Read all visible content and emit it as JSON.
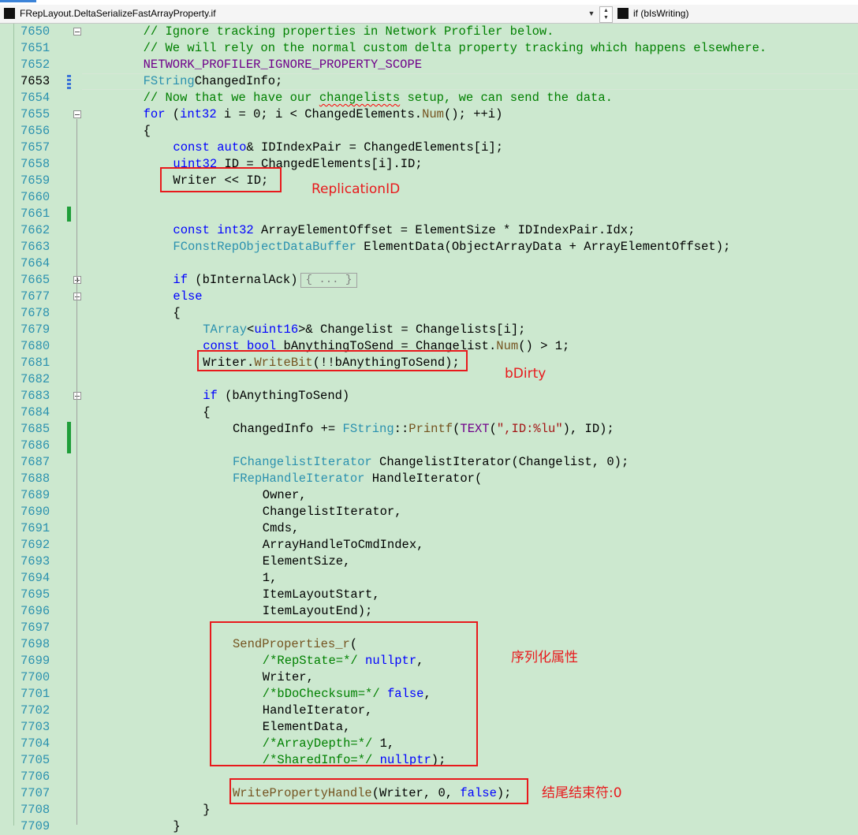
{
  "navbar": {
    "scope": "FRepLayout.DeltaSerializeFastArrayProperty.if",
    "member": "if (bIsWriting)"
  },
  "editor": {
    "active_line": "7653",
    "lines": [
      {
        "n": "7650",
        "fold": "minus",
        "t": [
          [
            "cm",
            "// Ignore tracking properties in Network Profiler below."
          ]
        ],
        "ind": 2
      },
      {
        "n": "7651",
        "t": [
          [
            "cm",
            "// We will rely on the normal custom delta property tracking which happens elsewhere."
          ]
        ],
        "ind": 2
      },
      {
        "n": "7652",
        "t": [
          [
            "mac",
            "NETWORK_PROFILER_IGNORE_PROPERTY_SCOPE"
          ]
        ],
        "ind": 2
      },
      {
        "n": "7653",
        "t": [
          [
            "ty",
            "FString"
          ],
          [
            "",
            "ChangedInfo;"
          ]
        ],
        "ind": 2,
        "sp": [
          1
        ]
      },
      {
        "n": "7654",
        "t": [
          [
            "cm",
            "// Now that we have our "
          ],
          [
            "cmsq",
            "changelists"
          ],
          [
            "cm",
            " setup, we can send the data."
          ]
        ],
        "ind": 2
      },
      {
        "n": "7655",
        "fold": "minus",
        "t": [
          [
            "kw",
            "for"
          ],
          [
            "",
            " ("
          ],
          [
            "kw",
            "int32"
          ],
          [
            "",
            " i = 0; i < ChangedElements."
          ],
          [
            "fn",
            "Num"
          ],
          [
            "",
            "(); ++i)"
          ]
        ],
        "ind": 2
      },
      {
        "n": "7656",
        "t": [
          [
            "",
            "{"
          ]
        ],
        "ind": 2
      },
      {
        "n": "7657",
        "t": [
          [
            "kw",
            "const"
          ],
          [
            "",
            " "
          ],
          [
            "kw",
            "auto"
          ],
          [
            "",
            "& IDIndexPair = ChangedElements[i];"
          ]
        ],
        "ind": 3
      },
      {
        "n": "7658",
        "t": [
          [
            "kw",
            "uint32"
          ],
          [
            "",
            " ID = ChangedElements[i].ID;"
          ]
        ],
        "ind": 3
      },
      {
        "n": "7659",
        "t": [
          [
            "",
            "Writer << ID;"
          ]
        ],
        "ind": 3
      },
      {
        "n": "7660",
        "t": [],
        "ind": 3
      },
      {
        "n": "7661",
        "t": [],
        "ind": 3
      },
      {
        "n": "7662",
        "t": [
          [
            "kw",
            "const"
          ],
          [
            "",
            " "
          ],
          [
            "kw",
            "int32"
          ],
          [
            "",
            " ArrayElementOffset = ElementSize * IDIndexPair.Idx;"
          ]
        ],
        "ind": 3
      },
      {
        "n": "7663",
        "t": [
          [
            "ty",
            "FConstRepObjectDataBuffer"
          ],
          [
            "",
            " ElementData(ObjectArrayData + ArrayElementOffset);"
          ]
        ],
        "ind": 3
      },
      {
        "n": "7664",
        "t": [],
        "ind": 3
      },
      {
        "n": "7665",
        "fold": "plus",
        "t": [
          [
            "kw",
            "if"
          ],
          [
            "",
            " (bInternalAck)"
          ],
          [
            "col",
            "{ ... }"
          ]
        ],
        "ind": 3
      },
      {
        "n": "7677",
        "fold": "minus",
        "t": [
          [
            "kw",
            "else"
          ]
        ],
        "ind": 3
      },
      {
        "n": "7678",
        "t": [
          [
            "",
            "{"
          ]
        ],
        "ind": 3
      },
      {
        "n": "7679",
        "t": [
          [
            "ty",
            "TArray"
          ],
          [
            "",
            "<"
          ],
          [
            "kw",
            "uint16"
          ],
          [
            "",
            ">& Changelist = Changelists[i];"
          ]
        ],
        "ind": 4
      },
      {
        "n": "7680",
        "t": [
          [
            "kw",
            "const"
          ],
          [
            "",
            " "
          ],
          [
            "kw",
            "bool"
          ],
          [
            "",
            " bAnythingToSend = Changelist."
          ],
          [
            "fn",
            "Num"
          ],
          [
            "",
            "() > 1;"
          ]
        ],
        "ind": 4
      },
      {
        "n": "7681",
        "t": [
          [
            "",
            "Writer."
          ],
          [
            "fn",
            "WriteBit"
          ],
          [
            "",
            "(!!bAnythingToSend);"
          ]
        ],
        "ind": 4
      },
      {
        "n": "7682",
        "t": [],
        "ind": 4
      },
      {
        "n": "7683",
        "fold": "minus",
        "t": [
          [
            "kw",
            "if"
          ],
          [
            "",
            " (bAnythingToSend)"
          ]
        ],
        "ind": 4
      },
      {
        "n": "7684",
        "t": [
          [
            "",
            "{"
          ]
        ],
        "ind": 4
      },
      {
        "n": "7685",
        "t": [
          [
            "",
            "ChangedInfo += "
          ],
          [
            "ty",
            "FString"
          ],
          [
            "",
            "::"
          ],
          [
            "fn",
            "Printf"
          ],
          [
            "",
            "("
          ],
          [
            "mac",
            "TEXT"
          ],
          [
            "",
            "("
          ],
          [
            "st",
            "\",ID:%lu\""
          ],
          [
            "",
            "), ID);"
          ]
        ],
        "ind": 5
      },
      {
        "n": "7686",
        "t": [],
        "ind": 5
      },
      {
        "n": "7687",
        "t": [
          [
            "ty",
            "FChangelistIterator"
          ],
          [
            "",
            " ChangelistIterator(Changelist, 0);"
          ]
        ],
        "ind": 5
      },
      {
        "n": "7688",
        "t": [
          [
            "ty",
            "FRepHandleIterator"
          ],
          [
            "",
            " HandleIterator("
          ]
        ],
        "ind": 5
      },
      {
        "n": "7689",
        "t": [
          [
            "",
            "Owner,"
          ]
        ],
        "ind": 6
      },
      {
        "n": "7690",
        "t": [
          [
            "",
            "ChangelistIterator,"
          ]
        ],
        "ind": 6
      },
      {
        "n": "7691",
        "t": [
          [
            "",
            "Cmds,"
          ]
        ],
        "ind": 6
      },
      {
        "n": "7692",
        "t": [
          [
            "",
            "ArrayHandleToCmdIndex,"
          ]
        ],
        "ind": 6
      },
      {
        "n": "7693",
        "t": [
          [
            "",
            "ElementSize,"
          ]
        ],
        "ind": 6
      },
      {
        "n": "7694",
        "t": [
          [
            "",
            "1,"
          ]
        ],
        "ind": 6
      },
      {
        "n": "7695",
        "t": [
          [
            "",
            "ItemLayoutStart,"
          ]
        ],
        "ind": 6
      },
      {
        "n": "7696",
        "t": [
          [
            "",
            "ItemLayoutEnd);"
          ]
        ],
        "ind": 6
      },
      {
        "n": "7697",
        "t": [],
        "ind": 6
      },
      {
        "n": "7698",
        "t": [
          [
            "fn",
            "SendProperties_r"
          ],
          [
            "",
            "("
          ]
        ],
        "ind": 5
      },
      {
        "n": "7699",
        "t": [
          [
            "cm",
            "/*RepState=*/"
          ],
          [
            "",
            " "
          ],
          [
            "kw",
            "nullptr"
          ],
          [
            "",
            ","
          ]
        ],
        "ind": 6
      },
      {
        "n": "7700",
        "t": [
          [
            "",
            "Writer,"
          ]
        ],
        "ind": 6
      },
      {
        "n": "7701",
        "t": [
          [
            "cm",
            "/*bDoChecksum=*/"
          ],
          [
            "",
            " "
          ],
          [
            "kw",
            "false"
          ],
          [
            "",
            ","
          ]
        ],
        "ind": 6
      },
      {
        "n": "7702",
        "t": [
          [
            "",
            "HandleIterator,"
          ]
        ],
        "ind": 6
      },
      {
        "n": "7703",
        "t": [
          [
            "",
            "ElementData,"
          ]
        ],
        "ind": 6
      },
      {
        "n": "7704",
        "t": [
          [
            "cm",
            "/*ArrayDepth=*/"
          ],
          [
            "",
            " 1,"
          ]
        ],
        "ind": 6
      },
      {
        "n": "7705",
        "t": [
          [
            "cm",
            "/*SharedInfo=*/"
          ],
          [
            "",
            " "
          ],
          [
            "kw",
            "nullptr"
          ],
          [
            "",
            ");"
          ]
        ],
        "ind": 6
      },
      {
        "n": "7706",
        "t": [],
        "ind": 6
      },
      {
        "n": "7707",
        "t": [
          [
            "fn",
            "WritePropertyHandle"
          ],
          [
            "",
            "(Writer, 0, "
          ],
          [
            "kw",
            "false"
          ],
          [
            "",
            ");"
          ]
        ],
        "ind": 5
      },
      {
        "n": "7708",
        "t": [
          [
            "",
            "}"
          ]
        ],
        "ind": 4
      },
      {
        "n": "7709",
        "t": [
          [
            "",
            "}"
          ]
        ],
        "ind": 3
      }
    ]
  },
  "annotations": {
    "replication_id": "ReplicationID",
    "bdirty": "bDirty",
    "serialize_props": "序列化属性",
    "end_marker": "结尾结束符:0"
  },
  "colors": {
    "background": "#cce8cf",
    "annotation": "#e8191c",
    "keyword": "#0000ff",
    "type": "#2b91af",
    "comment": "#008000",
    "change_bar": "#1f9e3a"
  }
}
